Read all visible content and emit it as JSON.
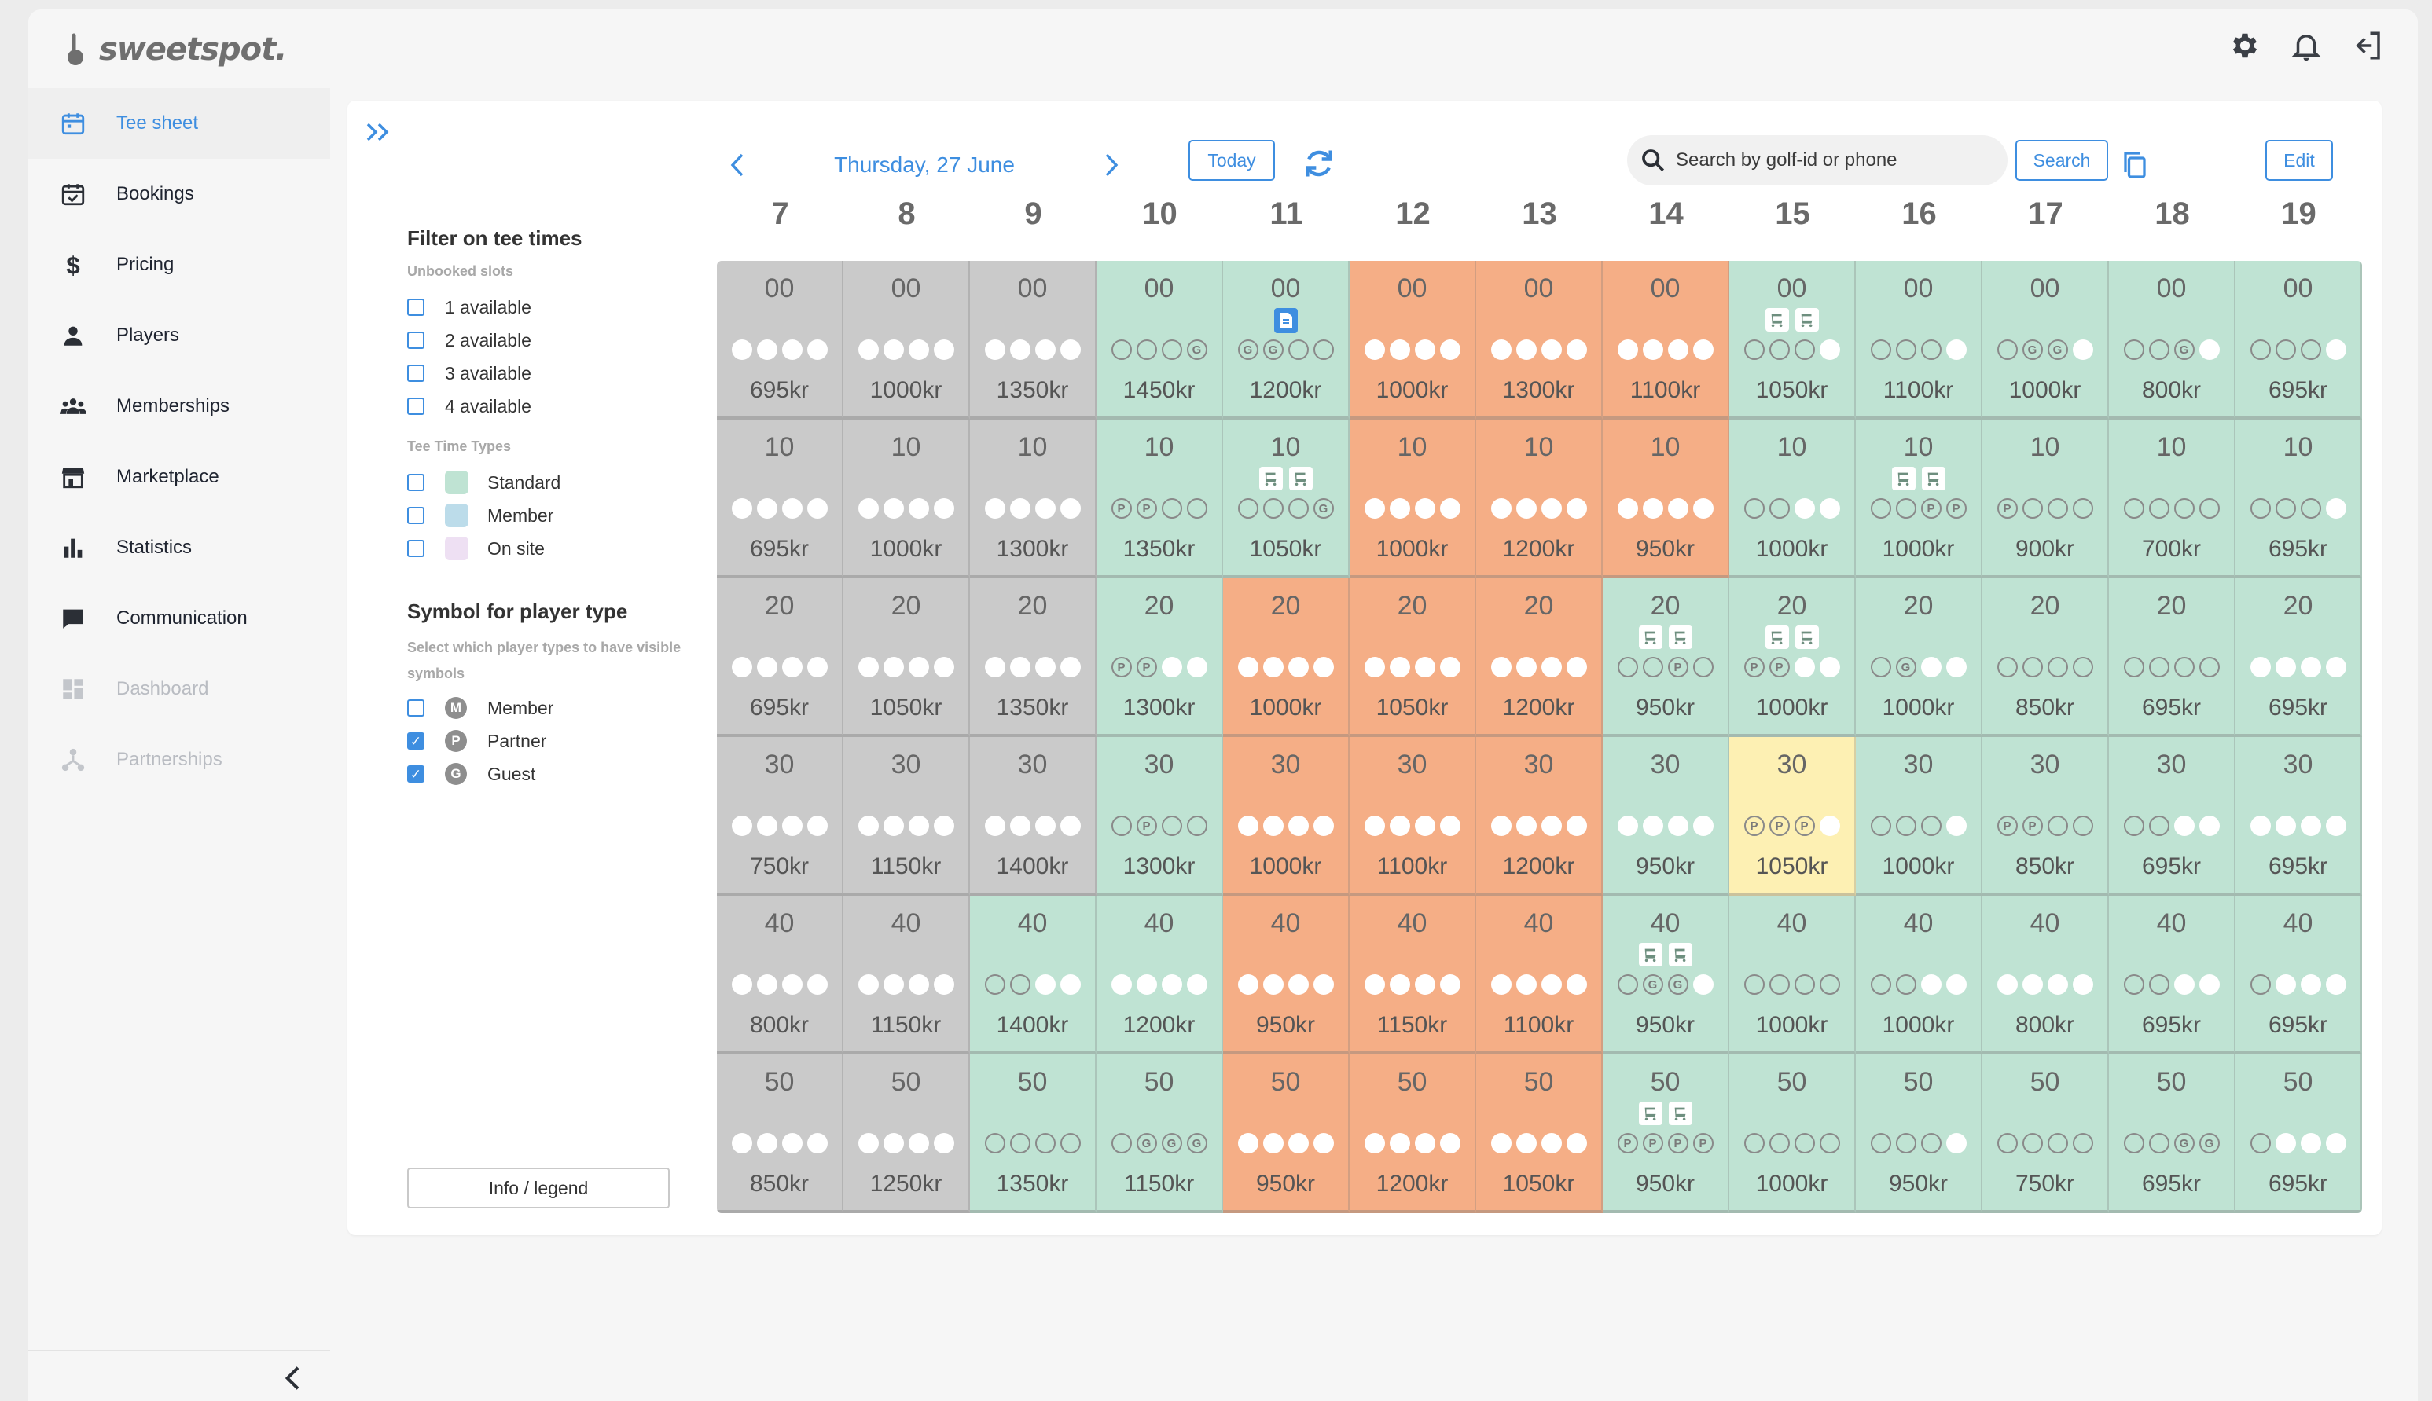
{
  "app": {
    "logo_text": "sweetspot."
  },
  "sidebar": {
    "items": [
      {
        "key": "tee-sheet",
        "label": "Tee sheet",
        "state": "active"
      },
      {
        "key": "bookings",
        "label": "Bookings",
        "state": "normal"
      },
      {
        "key": "pricing",
        "label": "Pricing",
        "state": "normal"
      },
      {
        "key": "players",
        "label": "Players",
        "state": "normal"
      },
      {
        "key": "memberships",
        "label": "Memberships",
        "state": "normal"
      },
      {
        "key": "marketplace",
        "label": "Marketplace",
        "state": "normal"
      },
      {
        "key": "statistics",
        "label": "Statistics",
        "state": "normal"
      },
      {
        "key": "communication",
        "label": "Communication",
        "state": "normal"
      },
      {
        "key": "dashboard",
        "label": "Dashboard",
        "state": "disabled"
      },
      {
        "key": "partnerships",
        "label": "Partnerships",
        "state": "disabled"
      }
    ]
  },
  "filters": {
    "title": "Filter on tee times",
    "unbooked_label": "Unbooked slots",
    "unbooked": [
      {
        "label": "1 available",
        "checked": false
      },
      {
        "label": "2 available",
        "checked": false
      },
      {
        "label": "3 available",
        "checked": false
      },
      {
        "label": "4 available",
        "checked": false
      }
    ],
    "types_label": "Tee Time Types",
    "types": [
      {
        "label": "Standard",
        "color": "#bfe3d3",
        "checked": false
      },
      {
        "label": "Member",
        "color": "#bcdcea",
        "checked": false
      },
      {
        "label": "On site",
        "color": "#eee0f3",
        "checked": false
      }
    ],
    "symbol_title": "Symbol for player type",
    "symbol_sub": "Select which player types to have visible symbols",
    "symbols": [
      {
        "label": "Member",
        "letter": "M",
        "checked": false
      },
      {
        "label": "Partner",
        "letter": "P",
        "checked": true
      },
      {
        "label": "Guest",
        "letter": "G",
        "checked": true
      }
    ],
    "info_button": "Info / legend"
  },
  "toolbar": {
    "date": "Thursday, 27 June",
    "today_label": "Today",
    "search_placeholder": "Search by golf-id or phone",
    "search_value": "",
    "search_label": "Search",
    "edit_label": "Edit"
  },
  "colors": {
    "accent": "#3e8ee0",
    "gray": "#cacaca",
    "green": "#bfe3d3",
    "orange": "#f5ae86",
    "yellow": "#fdf0b3"
  },
  "legend_codes": {
    "F": "booked",
    "E": "available",
    "P": "partner",
    "G": "guest"
  },
  "tee_sheet": {
    "hours": [
      "7",
      "8",
      "9",
      "10",
      "11",
      "12",
      "13",
      "14",
      "15",
      "16",
      "17",
      "18",
      "19"
    ],
    "rows": [
      {
        "minute": "00",
        "cells": [
          {
            "color": "gray",
            "dots": "FFFF",
            "price": "695kr"
          },
          {
            "color": "gray",
            "dots": "FFFF",
            "price": "1000kr"
          },
          {
            "color": "gray",
            "dots": "FFFF",
            "price": "1350kr"
          },
          {
            "color": "green",
            "dots": "EEEG",
            "price": "1450kr"
          },
          {
            "color": "green",
            "dots": "GGEE",
            "price": "1200kr",
            "icons": [
              "doc"
            ]
          },
          {
            "color": "orange",
            "dots": "FFFF",
            "price": "1000kr"
          },
          {
            "color": "orange",
            "dots": "FFFF",
            "price": "1300kr"
          },
          {
            "color": "orange",
            "dots": "FFFF",
            "price": "1100kr"
          },
          {
            "color": "green",
            "dots": "EEEF",
            "price": "1050kr",
            "icons": [
              "cart",
              "cart"
            ]
          },
          {
            "color": "green",
            "dots": "EEEF",
            "price": "1100kr"
          },
          {
            "color": "green",
            "dots": "EGGF",
            "price": "1000kr"
          },
          {
            "color": "green",
            "dots": "EEGF",
            "price": "800kr"
          },
          {
            "color": "green",
            "dots": "EEEF",
            "price": "695kr"
          }
        ]
      },
      {
        "minute": "10",
        "cells": [
          {
            "color": "gray",
            "dots": "FFFF",
            "price": "695kr"
          },
          {
            "color": "gray",
            "dots": "FFFF",
            "price": "1000kr"
          },
          {
            "color": "gray",
            "dots": "FFFF",
            "price": "1300kr"
          },
          {
            "color": "green",
            "dots": "PPEE",
            "price": "1350kr"
          },
          {
            "color": "green",
            "dots": "EEEG",
            "price": "1050kr",
            "icons": [
              "cart",
              "cart"
            ]
          },
          {
            "color": "orange",
            "dots": "FFFF",
            "price": "1000kr"
          },
          {
            "color": "orange",
            "dots": "FFFF",
            "price": "1200kr"
          },
          {
            "color": "orange",
            "dots": "FFFF",
            "price": "950kr"
          },
          {
            "color": "green",
            "dots": "EEFF",
            "price": "1000kr"
          },
          {
            "color": "green",
            "dots": "EEPP",
            "price": "1000kr",
            "icons": [
              "cart",
              "cart"
            ]
          },
          {
            "color": "green",
            "dots": "PEEE",
            "price": "900kr"
          },
          {
            "color": "green",
            "dots": "EEEE",
            "price": "700kr"
          },
          {
            "color": "green",
            "dots": "EEEF",
            "price": "695kr"
          }
        ]
      },
      {
        "minute": "20",
        "cells": [
          {
            "color": "gray",
            "dots": "FFFF",
            "price": "695kr"
          },
          {
            "color": "gray",
            "dots": "FFFF",
            "price": "1050kr"
          },
          {
            "color": "gray",
            "dots": "FFFF",
            "price": "1350kr"
          },
          {
            "color": "green",
            "dots": "PPFF",
            "price": "1300kr"
          },
          {
            "color": "orange",
            "dots": "FFFF",
            "price": "1000kr"
          },
          {
            "color": "orange",
            "dots": "FFFF",
            "price": "1050kr"
          },
          {
            "color": "orange",
            "dots": "FFFF",
            "price": "1200kr"
          },
          {
            "color": "green",
            "dots": "EEPE",
            "price": "950kr",
            "icons": [
              "cart",
              "cart"
            ]
          },
          {
            "color": "green",
            "dots": "PPFF",
            "price": "1000kr",
            "icons": [
              "cart",
              "cart"
            ]
          },
          {
            "color": "green",
            "dots": "EGFF",
            "price": "1000kr"
          },
          {
            "color": "green",
            "dots": "EEEE",
            "price": "850kr"
          },
          {
            "color": "green",
            "dots": "EEEE",
            "price": "695kr"
          },
          {
            "color": "green",
            "dots": "FFFF",
            "price": "695kr"
          }
        ]
      },
      {
        "minute": "30",
        "cells": [
          {
            "color": "gray",
            "dots": "FFFF",
            "price": "750kr"
          },
          {
            "color": "gray",
            "dots": "FFFF",
            "price": "1150kr"
          },
          {
            "color": "gray",
            "dots": "FFFF",
            "price": "1400kr"
          },
          {
            "color": "green",
            "dots": "EPEE",
            "price": "1300kr"
          },
          {
            "color": "orange",
            "dots": "FFFF",
            "price": "1000kr"
          },
          {
            "color": "orange",
            "dots": "FFFF",
            "price": "1100kr"
          },
          {
            "color": "orange",
            "dots": "FFFF",
            "price": "1200kr"
          },
          {
            "color": "green",
            "dots": "FFFF",
            "price": "950kr"
          },
          {
            "color": "yellow",
            "dots": "PPPF",
            "price": "1050kr"
          },
          {
            "color": "green",
            "dots": "EEEF",
            "price": "1000kr"
          },
          {
            "color": "green",
            "dots": "PPEE",
            "price": "850kr"
          },
          {
            "color": "green",
            "dots": "EEFF",
            "price": "695kr"
          },
          {
            "color": "green",
            "dots": "FFFF",
            "price": "695kr"
          }
        ]
      },
      {
        "minute": "40",
        "cells": [
          {
            "color": "gray",
            "dots": "FFFF",
            "price": "800kr"
          },
          {
            "color": "gray",
            "dots": "FFFF",
            "price": "1150kr"
          },
          {
            "color": "green",
            "dots": "EEFF",
            "price": "1400kr"
          },
          {
            "color": "green",
            "dots": "FFFF",
            "price": "1200kr"
          },
          {
            "color": "orange",
            "dots": "FFFF",
            "price": "950kr"
          },
          {
            "color": "orange",
            "dots": "FFFF",
            "price": "1150kr"
          },
          {
            "color": "orange",
            "dots": "FFFF",
            "price": "1100kr"
          },
          {
            "color": "green",
            "dots": "EGGF",
            "price": "950kr",
            "icons": [
              "cart",
              "cart"
            ]
          },
          {
            "color": "green",
            "dots": "EEEE",
            "price": "1000kr"
          },
          {
            "color": "green",
            "dots": "EEFF",
            "price": "1000kr"
          },
          {
            "color": "green",
            "dots": "FFFF",
            "price": "800kr"
          },
          {
            "color": "green",
            "dots": "EEFF",
            "price": "695kr"
          },
          {
            "color": "green",
            "dots": "EFFF",
            "price": "695kr"
          }
        ]
      },
      {
        "minute": "50",
        "cells": [
          {
            "color": "gray",
            "dots": "FFFF",
            "price": "850kr"
          },
          {
            "color": "gray",
            "dots": "FFFF",
            "price": "1250kr"
          },
          {
            "color": "green",
            "dots": "EEEE",
            "price": "1350kr"
          },
          {
            "color": "green",
            "dots": "EGGG",
            "price": "1150kr"
          },
          {
            "color": "orange",
            "dots": "FFFF",
            "price": "950kr"
          },
          {
            "color": "orange",
            "dots": "FFFF",
            "price": "1200kr"
          },
          {
            "color": "orange",
            "dots": "FFFF",
            "price": "1050kr"
          },
          {
            "color": "green",
            "dots": "PPPP",
            "price": "950kr",
            "icons": [
              "cart",
              "cart"
            ]
          },
          {
            "color": "green",
            "dots": "EEEE",
            "price": "1000kr"
          },
          {
            "color": "green",
            "dots": "EEEF",
            "price": "950kr"
          },
          {
            "color": "green",
            "dots": "EEEE",
            "price": "750kr"
          },
          {
            "color": "green",
            "dots": "EEGG",
            "price": "695kr"
          },
          {
            "color": "green",
            "dots": "EFFF",
            "price": "695kr"
          }
        ]
      }
    ]
  }
}
